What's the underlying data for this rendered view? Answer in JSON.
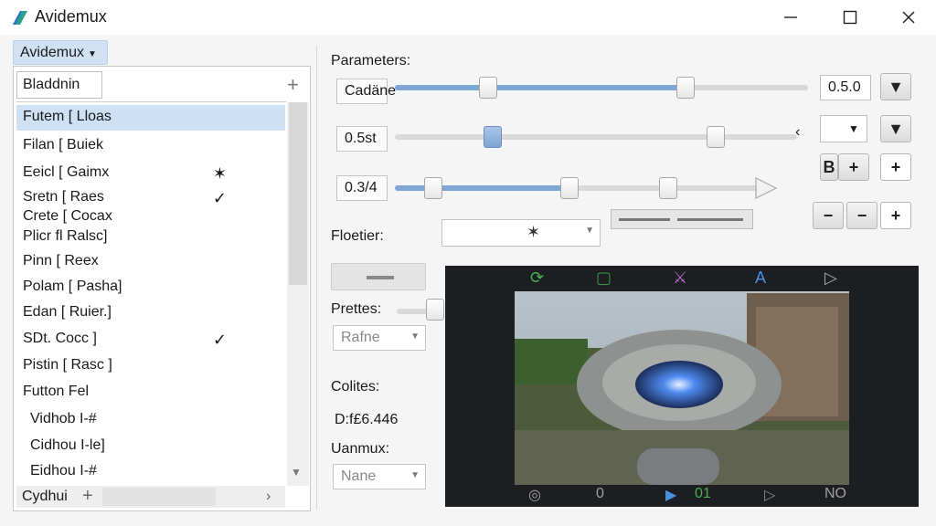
{
  "window": {
    "title": "Avidemux",
    "minimize_icon": "minimize-icon",
    "maximize_icon": "maximize-icon",
    "close_icon": "close-icon"
  },
  "left": {
    "menu_label": "Avidemux",
    "search_value": "Blаddnin",
    "items": [
      {
        "label": "Futem [ Lloas",
        "selected": true,
        "check": ""
      },
      {
        "label": "Filan [ Buiek",
        "selected": false,
        "check": ""
      },
      {
        "label": "Eeicl [ Gaimx",
        "selected": false,
        "check": "✶"
      },
      {
        "label": "Sretn [ Raes",
        "selected": false,
        "check": "✓"
      },
      {
        "label": "Crete [ Cocax",
        "selected": false,
        "check": ""
      },
      {
        "label": "Plicr fl Ralsc]",
        "selected": false,
        "check": ""
      },
      {
        "label": "Pinn [ Reex",
        "selected": false,
        "check": ""
      },
      {
        "label": "Polam [ Pasha]",
        "selected": false,
        "check": ""
      },
      {
        "label": "Edan [ Ruier.]",
        "selected": false,
        "check": ""
      },
      {
        "label": "SDt. Cocc ]",
        "selected": false,
        "check": "✓"
      },
      {
        "label": "Pistin [ Rasc ]",
        "selected": false,
        "check": ""
      },
      {
        "label": "Futton Fel",
        "selected": false,
        "check": ""
      },
      {
        "label": "Vidhob I-#",
        "selected": false,
        "check": "",
        "sub": true
      },
      {
        "label": "Cidhou I-le]",
        "selected": false,
        "check": "",
        "sub": true
      },
      {
        "label": "Eidhou I-#",
        "selected": false,
        "check": "",
        "sub": true
      }
    ],
    "bottom_label": "Cydhui"
  },
  "params": {
    "title": "Parameters:",
    "rows": [
      {
        "label": "Cadäne",
        "value": "0.5.0"
      },
      {
        "label": "0.5st",
        "value": ""
      },
      {
        "label": "0.3/4",
        "value": ""
      }
    ],
    "floater_label": "Floetier:",
    "floater_icon": "✶",
    "prettes_label": "Prettes:",
    "prettes_dd": "Rafne",
    "colites_label": "Colites:",
    "colites_value": "D:f£6.446",
    "uanmux_label": "Uanmux:",
    "uanmux_dd": "Nane",
    "btn_b": "B",
    "plus": "+",
    "minus": "−"
  },
  "preview": {
    "icons": [
      "refresh-icon",
      "square-icon",
      "brush-icon",
      "text-icon",
      "play-outline-icon"
    ],
    "icon_glyphs": [
      "⟳",
      "▢",
      "⚔",
      "A",
      "▷"
    ],
    "bottom": {
      "left": "◎",
      "mark": "0",
      "play": "▶",
      "counter": "01",
      "next": "▷",
      "end": "NO"
    }
  },
  "colors": {
    "accent": "#7fa6d6",
    "selection": "#cde0f4",
    "preview_bg": "#1c1e22"
  }
}
